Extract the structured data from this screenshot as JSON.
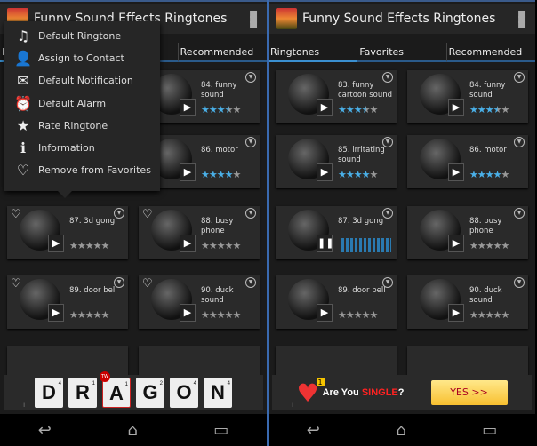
{
  "app": {
    "title": "Funny Sound Effects Ringtones",
    "overflow_icon": "overflow-menu-icon"
  },
  "tabs": [
    "Ringtones",
    "Favorites",
    "Recommended"
  ],
  "colors": {
    "accent": "#3a8fd0",
    "star_on": "#4ab0e8",
    "star_off": "#999999"
  },
  "context_menu": [
    {
      "icon": "♫",
      "icon_name": "music-note-icon",
      "label": "Default Ringtone"
    },
    {
      "icon": "👤",
      "icon_name": "contact-icon",
      "label": "Assign to Contact"
    },
    {
      "icon": "✉",
      "icon_name": "envelope-icon",
      "label": "Default Notification"
    },
    {
      "icon": "⏰",
      "icon_name": "alarm-clock-icon",
      "label": "Default Alarm"
    },
    {
      "icon": "★",
      "icon_name": "star-icon",
      "label": "Rate Ringtone"
    },
    {
      "icon": "ℹ",
      "icon_name": "info-icon",
      "label": "Information"
    },
    {
      "icon": "♡",
      "icon_name": "heart-icon",
      "label": "Remove from Favorites"
    }
  ],
  "left_panel": {
    "cards": [
      {
        "name": "",
        "rating": 0,
        "hidden": true
      },
      {
        "name": "84. funny sound",
        "rating": 3.5
      },
      {
        "name": "",
        "rating": 0,
        "hidden": true
      },
      {
        "name": "86. motor",
        "rating": 4
      },
      {
        "name": "87. 3d gong",
        "rating": 0,
        "favorite": true
      },
      {
        "name": "88. busy phone",
        "rating": 0,
        "favorite": true
      },
      {
        "name": "89. door bell",
        "rating": 0,
        "favorite": true
      },
      {
        "name": "90. duck sound",
        "rating": 0,
        "favorite": true
      }
    ],
    "ad": {
      "tiles": [
        {
          "l": "D",
          "n": "4"
        },
        {
          "l": "R",
          "n": "1"
        },
        {
          "l": "A",
          "n": "1"
        },
        {
          "l": "G",
          "n": "2"
        },
        {
          "l": "O",
          "n": "4"
        },
        {
          "l": "N",
          "n": "4"
        }
      ],
      "tw_badge": "TW",
      "info": "i"
    }
  },
  "right_panel": {
    "cards": [
      {
        "name": "83. funny cartoon sound",
        "rating": 3.5
      },
      {
        "name": "84. funny sound",
        "rating": 3.5
      },
      {
        "name": "85. irritating sound",
        "rating": 4
      },
      {
        "name": "86. motor",
        "rating": 4
      },
      {
        "name": "87. 3d gong",
        "rating": 0,
        "playing": true
      },
      {
        "name": "88. busy phone",
        "rating": 0
      },
      {
        "name": "89. door bell",
        "rating": 0
      },
      {
        "name": "90. duck sound",
        "rating": 0
      }
    ],
    "ad": {
      "badge": "1",
      "q1": "Are You ",
      "q2": "SINGLE",
      "q3": "?",
      "yes": "YES >>",
      "info": "i"
    }
  },
  "nav": {
    "back": "↩",
    "home": "⌂",
    "recents": "▭"
  }
}
